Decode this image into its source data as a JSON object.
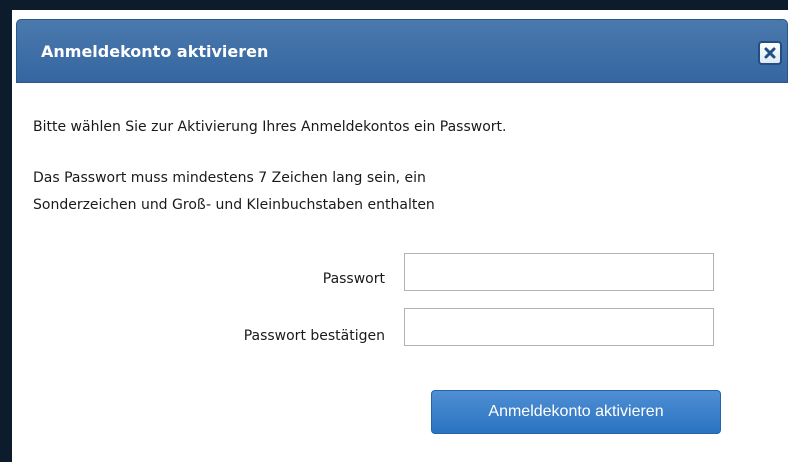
{
  "dialog": {
    "title": "Anmeldekonto aktivieren",
    "close_icon": "close-icon",
    "intro_text": "Bitte wählen Sie zur Aktivierung Ihres Anmeldekontos ein Passwort.",
    "requirements_line1": "Das Passwort muss mindestens 7 Zeichen lang sein, ein",
    "requirements_line2": "Sonderzeichen und Groß- und Kleinbuchstaben enthalten",
    "password_label": "Passwort",
    "password_value": "",
    "confirm_label": "Passwort bestätigen",
    "confirm_value": "",
    "submit_label": "Anmeldekonto aktivieren"
  },
  "colors": {
    "titlebar": "#3d6ea6",
    "button": "#3a7fcb",
    "backdrop": "#0d1c2c"
  }
}
